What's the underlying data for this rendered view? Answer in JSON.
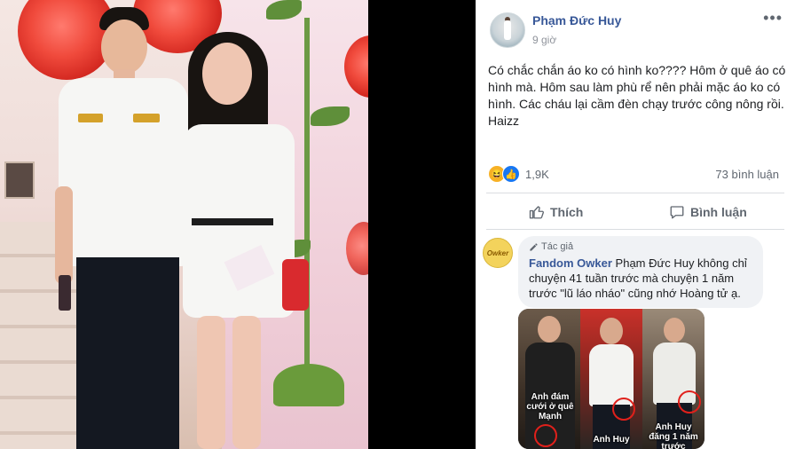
{
  "post": {
    "author": "Phạm Đức Huy",
    "time": "9 giờ",
    "more_label": "•••",
    "text": "Có chắc chắn áo ko có hình ko???? Hôm ở quê áo có hình mà. Hôm sau làm phù rể nên phải mặc áo ko có hình. Các cháu lại cầm đèn chạy trước công nông rồi. Haizz",
    "reaction_count": "1,9K",
    "comment_count": "73 bình luận",
    "like_label": "Thích",
    "comment_label": "Bình luận",
    "reactions": [
      "haha-icon",
      "like-icon"
    ]
  },
  "comment": {
    "badge": "Tác giả",
    "author": "Fandom Owker",
    "avatar_text": "Owker",
    "text": "Phạm Đức Huy không chỉ chuyện 41 tuần trước mà chuyện 1 năm trước \"lũ láo nháo\" cũng nhớ Hoàng tử ạ.",
    "collage": {
      "caption_1": "Anh đám cưới ở quê Mạnh",
      "caption_2": "Anh Huy",
      "caption_3": "Anh Huy đăng 1 năm trước"
    }
  },
  "colors": {
    "author_blue": "#385898",
    "like_blue": "#1877f2",
    "text": "#1c1e21",
    "muted": "#606770"
  }
}
